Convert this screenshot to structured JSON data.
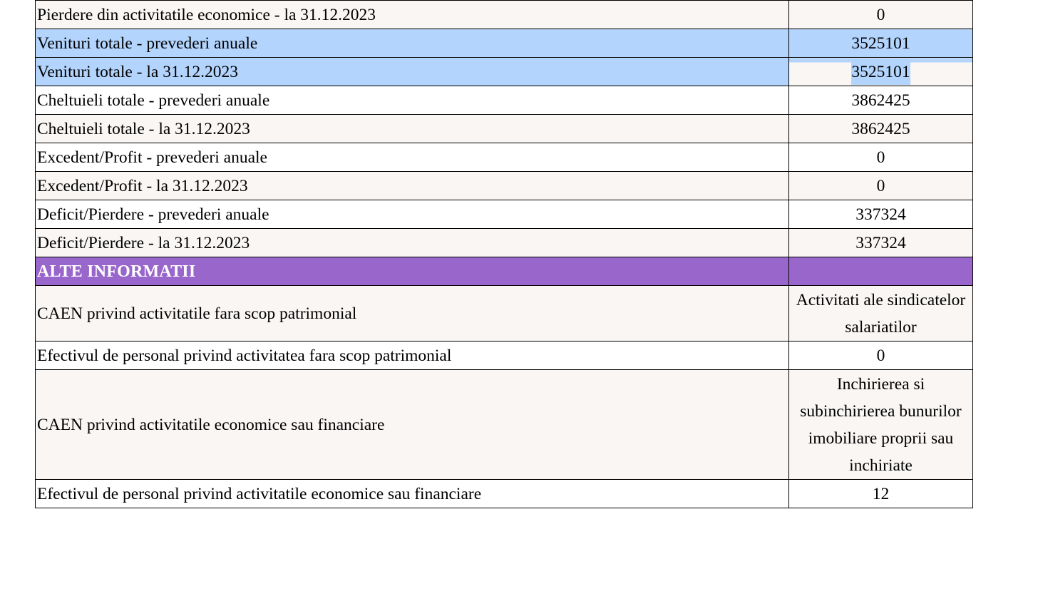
{
  "colors": {
    "row_background": "#f9f6f4",
    "row_background_alt": "#ffffff",
    "selection_highlight": "#b3d4fc",
    "section_header_background": "#9966cc",
    "section_header_text": "#ffffff",
    "border": "#000000"
  },
  "rows": [
    {
      "label": "Pierdere din activitatile economice - la 31.12.2023",
      "value": "0"
    },
    {
      "label": "Venituri totale - prevederi anuale",
      "value": "3525101"
    },
    {
      "label": "Venituri totale - la 31.12.2023",
      "value": "3525101"
    },
    {
      "label": "Cheltuieli totale - prevederi anuale",
      "value": "3862425"
    },
    {
      "label": "Cheltuieli totale - la 31.12.2023",
      "value": "3862425"
    },
    {
      "label": "Excedent/Profit - prevederi anuale",
      "value": "0"
    },
    {
      "label": "Excedent/Profit - la 31.12.2023",
      "value": "0"
    },
    {
      "label": "Deficit/Pierdere - prevederi anuale",
      "value": "337324"
    },
    {
      "label": "Deficit/Pierdere - la 31.12.2023",
      "value": "337324"
    }
  ],
  "section": {
    "title": "ALTE INFORMATII",
    "value": ""
  },
  "other_rows": [
    {
      "label": "CAEN privind activitatile fara scop patrimonial",
      "value": "Activitati ale sindicatelor salariatilor"
    },
    {
      "label": "Efectivul de personal privind activitatea fara scop patrimonial",
      "value": "0"
    },
    {
      "label": "CAEN privind activitatile economice sau financiare",
      "value": "Inchirierea si subinchirierea bunurilor imobiliare proprii sau inchiriate"
    },
    {
      "label": "Efectivul de personal privind activitatile economice sau financiare",
      "value": "12"
    }
  ]
}
